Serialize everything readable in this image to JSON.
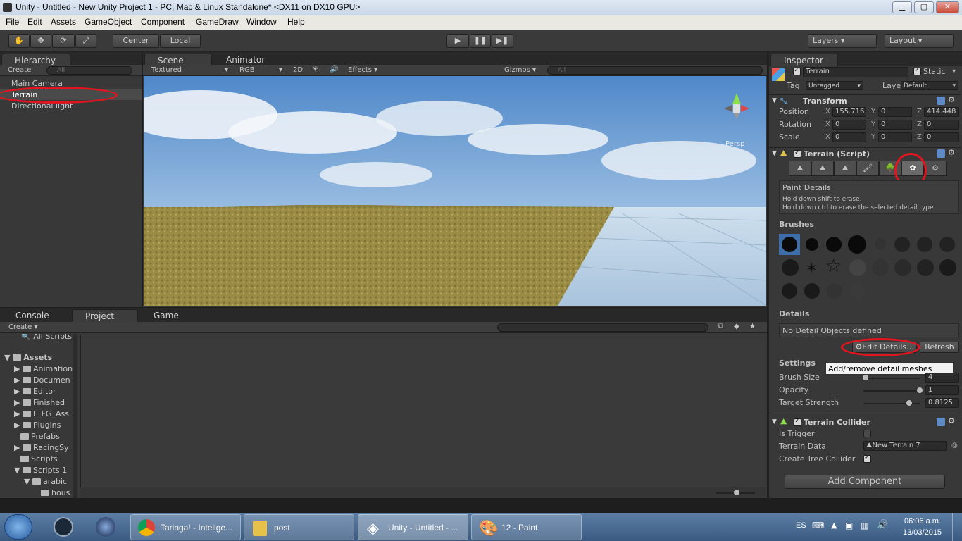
{
  "window": {
    "title": "Unity - Untitled - New Unity Project 1 - PC, Mac & Linux Standalone* <DX11 on DX10 GPU>"
  },
  "menu": [
    "File",
    "Edit",
    "Assets",
    "GameObject",
    "Component",
    "GameDraw",
    "Window",
    "Help"
  ],
  "toolbar": {
    "center_label": "Center",
    "local_label": "Local",
    "layers_label": "Layers",
    "layout_label": "Layout"
  },
  "hierarchy": {
    "tab": "Hierarchy",
    "create": "Create",
    "search_placeholder": "All",
    "items": [
      "Main Camera",
      "Terrain",
      "Directional light"
    ]
  },
  "scene": {
    "tab": "Scene",
    "tab2": "Animator",
    "render_mode": "Textured",
    "color_mode": "RGB",
    "mode_2d": "2D",
    "effects": "Effects",
    "gizmos": "Gizmos",
    "search_placeholder": "All",
    "persp": "Persp"
  },
  "bottom": {
    "tab_console": "Console",
    "tab_project": "Project",
    "tab_game": "Game",
    "create": "Create",
    "tree": [
      "All Scripts",
      "Assets",
      "Animation",
      "Documen",
      "Editor",
      "Finished",
      "L_FG_Ass",
      "Plugins",
      "Prefabs",
      "RacingSy",
      "Scripts",
      "Scripts 1",
      "arabic",
      "hous"
    ]
  },
  "inspector": {
    "tab": "Inspector",
    "object_name": "Terrain",
    "static_label": "Static",
    "tag_label": "Tag",
    "tag_value": "Untagged",
    "layer_label": "Layer",
    "layer_value": "Default",
    "transform": {
      "title": "Transform",
      "position_label": "Position",
      "rotation_label": "Rotation",
      "scale_label": "Scale",
      "position": {
        "x": "155.716",
        "y": "0",
        "z": "414.448"
      },
      "rotation": {
        "x": "0",
        "y": "0",
        "z": "0"
      },
      "scale": {
        "x": "0",
        "y": "0",
        "z": "0"
      }
    },
    "terrain_script": {
      "title": "Terrain (Script)",
      "paint_title": "Paint Details",
      "hint1": "Hold down shift to erase.",
      "hint2": "Hold down ctrl to erase the selected detail type.",
      "brushes_label": "Brushes",
      "details_label": "Details",
      "no_details": "No Detail Objects defined",
      "edit_details": "Edit Details...",
      "refresh": "Refresh",
      "settings_label": "Settings",
      "tooltip": "Add/remove detail meshes",
      "brush_size_label": "Brush Size",
      "brush_size": "4",
      "opacity_label": "Opacity",
      "opacity": "1",
      "target_strength_label": "Target Strength",
      "target_strength": "0.8125",
      "brush_size_level": 0.04,
      "opacity_level": 1.0,
      "target_strength_level": 0.8125
    },
    "collider": {
      "title": "Terrain Collider",
      "is_trigger_label": "Is Trigger",
      "terrain_data_label": "Terrain Data",
      "terrain_data": "New Terrain 7",
      "create_tree_label": "Create Tree Collider"
    },
    "add_component": "Add Component"
  },
  "taskbar": {
    "items": [
      "Taringa! - Intelige...",
      "post",
      "Unity - Untitled - ...",
      "12 - Paint"
    ],
    "lang": "ES",
    "time": "06:06 a.m.",
    "date": "13/03/2015"
  },
  "colors": {
    "accent_red": "#e2141d",
    "selection": "#3d6ea8",
    "sky_top": "#4f88c9",
    "ground": "#9a8c45"
  }
}
